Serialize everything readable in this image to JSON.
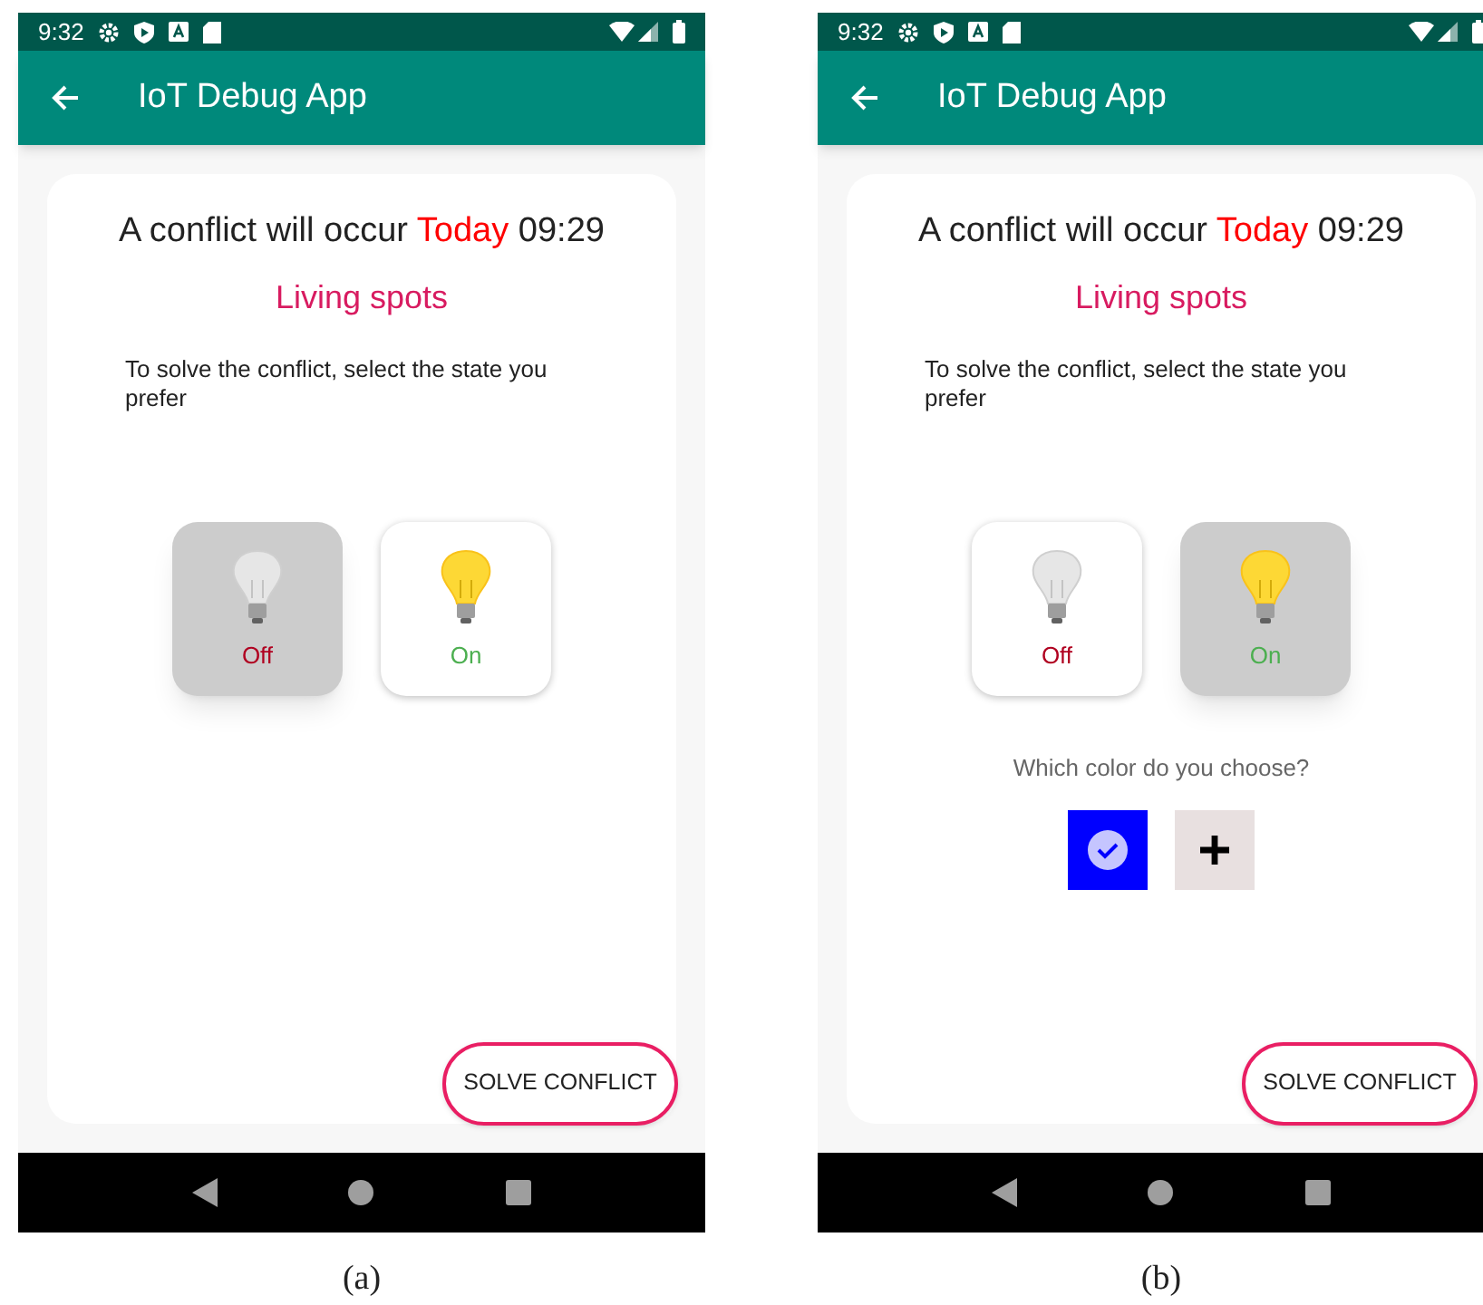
{
  "panels": [
    {
      "status_bar": {
        "time": "9:32"
      },
      "app_bar": {
        "title": "IoT Debug App"
      },
      "conflict": {
        "lead": "A conflict will occur",
        "day": "Today",
        "time": "09:29",
        "device": "Living spots",
        "instruction": "To solve the conflict, select the state you prefer"
      },
      "states": [
        {
          "kind": "off",
          "label": "Off",
          "selected": true
        },
        {
          "kind": "on",
          "label": "On",
          "selected": false
        }
      ],
      "button": "SOLVE CONFLICT",
      "caption": "(a)"
    },
    {
      "status_bar": {
        "time": "9:32"
      },
      "app_bar": {
        "title": "IoT Debug App"
      },
      "conflict": {
        "lead": "A conflict will occur",
        "day": "Today",
        "time": "09:29",
        "device": "Living spots",
        "instruction": "To solve the conflict, select the state you prefer"
      },
      "states": [
        {
          "kind": "off",
          "label": "Off",
          "selected": false
        },
        {
          "kind": "on",
          "label": "On",
          "selected": true
        }
      ],
      "color_choice": {
        "prompt": "Which color do you choose?",
        "swatches": [
          {
            "kind": "color",
            "color": "#0000ff",
            "selected": true
          },
          {
            "kind": "add",
            "selected": false
          }
        ]
      },
      "button": "SOLVE CONFLICT",
      "caption": "(b)"
    }
  ]
}
